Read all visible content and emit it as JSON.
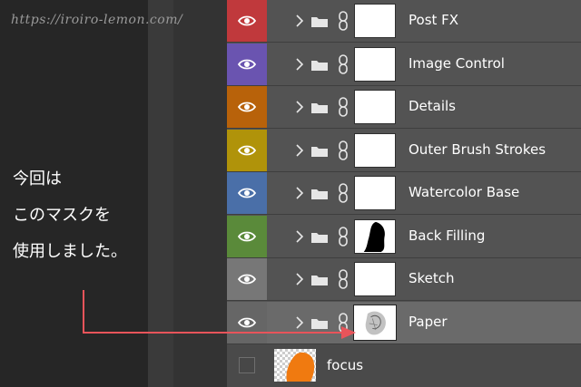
{
  "watermark": "https://iroiro-lemon.com/",
  "note": {
    "line1": "今回は",
    "line2": "このマスクを",
    "line3": "使用しました。"
  },
  "colors": {
    "arrow": "#e8545a",
    "row_colors": [
      "#c0393c",
      "#6a54b0",
      "#b8620a",
      "#b0930a",
      "#4a6fa8",
      "#5a8a3a",
      "#777777",
      "#666666"
    ]
  },
  "layers": [
    {
      "name": "Post FX",
      "color": "#c0393c"
    },
    {
      "name": "Image Control",
      "color": "#6a54b0"
    },
    {
      "name": "Details",
      "color": "#b8620a"
    },
    {
      "name": "Outer Brush Strokes",
      "color": "#b0930a"
    },
    {
      "name": "Watercolor Base",
      "color": "#4a6fa8"
    },
    {
      "name": "Back Filling",
      "color": "#5a8a3a"
    },
    {
      "name": "Sketch",
      "color": "#777777"
    },
    {
      "name": "Paper",
      "color": "#666666"
    }
  ],
  "bottom_layer": {
    "name": "focus"
  },
  "icons": {
    "visibility": "eye-icon",
    "expand": "chevron-right-icon",
    "group": "folder-icon",
    "link": "link-chain-icon"
  }
}
